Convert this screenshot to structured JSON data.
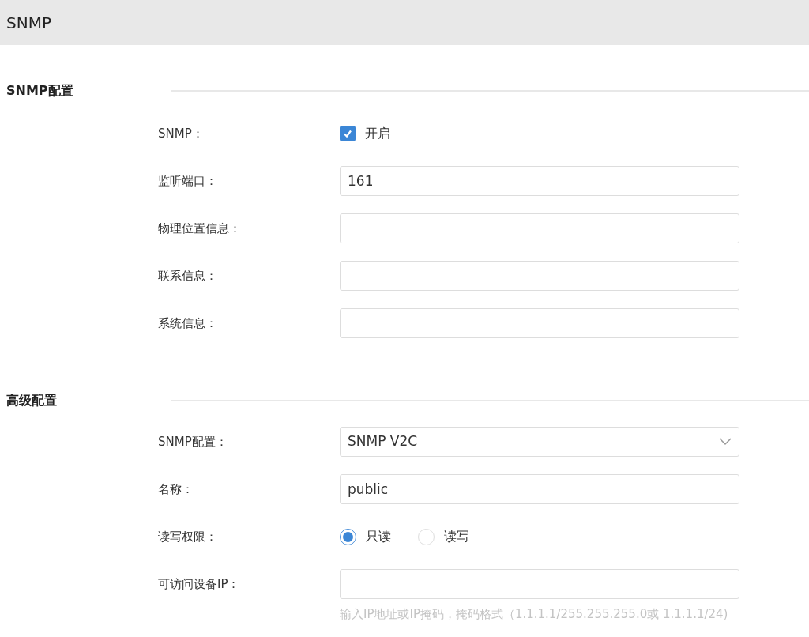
{
  "header": {
    "title": "SNMP"
  },
  "sections": [
    {
      "title": "SNMP配置",
      "rows": [
        {
          "kind": "checkbox",
          "label": "SNMP：",
          "option": "开启",
          "checked": true
        },
        {
          "kind": "text",
          "label": "监听端口：",
          "value": "161"
        },
        {
          "kind": "text",
          "label": "物理位置信息："
        },
        {
          "kind": "text",
          "label": "联系信息："
        },
        {
          "kind": "text",
          "label": "系统信息："
        }
      ]
    },
    {
      "title": "高级配置",
      "rows": [
        {
          "kind": "select",
          "label": "SNMP配置：",
          "value": "SNMP V2C"
        },
        {
          "kind": "text",
          "label": "名称：",
          "value": "public"
        },
        {
          "kind": "radio",
          "label": "读写权限：",
          "options": [
            {
              "label": "只读",
              "selected": true
            },
            {
              "label": "读写",
              "selected": false
            }
          ]
        },
        {
          "kind": "text",
          "label": "可访问设备IP：",
          "hint": "输入IP地址或IP掩码，掩码格式（1.1.1.1/255.255.255.0或 1.1.1.1/24)"
        }
      ]
    }
  ]
}
